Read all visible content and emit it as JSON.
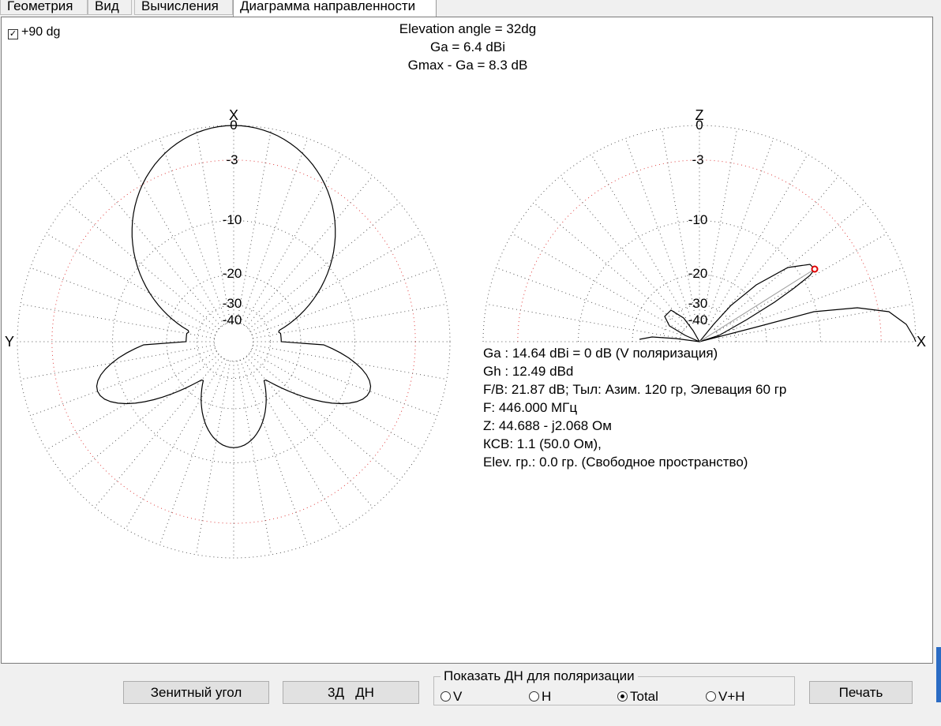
{
  "tabs": [
    {
      "label": "Геометрия",
      "active": false
    },
    {
      "label": "Вид",
      "active": false
    },
    {
      "label": "Вычисления",
      "active": false
    },
    {
      "label": "Диаграмма направленности",
      "active": true
    }
  ],
  "checkbox": {
    "label": "+90 dg",
    "checked": true,
    "glyph": "☑"
  },
  "header": {
    "elevation": "Elevation angle =  32dg",
    "ga": "Ga = 6.4 dBi",
    "gmax": "Gmax - Ga = 8.3 dB"
  },
  "azimuth_plot": {
    "top_axis": "X",
    "left_axis": "Y",
    "ring_labels": [
      "0",
      "-3",
      "-10",
      "-20",
      "-30",
      "-40"
    ]
  },
  "elevation_plot": {
    "top_axis": "Z",
    "right_axis": "X",
    "ring_labels": [
      "0",
      "-3",
      "-10",
      "-20",
      "-30",
      "-40"
    ]
  },
  "info_lines": [
    "Ga : 14.64 dBi = 0 dB  (V поляризация)",
    "Gh : 12.49 dBd",
    "F/B: 21.87 dB; Тыл: Азим. 120 гр, Элевация 60 гр",
    "F: 446.000 МГц",
    "Z: 44.688 - j2.068 Ом",
    "КСВ: 1.1 (50.0 Ом),",
    "Elev. гр.: 0.0 гр. (Свободное пространство)"
  ],
  "buttons": {
    "zenith": "Зенитный угол",
    "three_d": "3Д   ДН",
    "print": "Печать"
  },
  "polarization": {
    "title": "Показать ДН для поляризации",
    "options": [
      {
        "label": "V",
        "selected": false
      },
      {
        "label": "H",
        "selected": false
      },
      {
        "label": "Total",
        "selected": true
      },
      {
        "label": "V+H",
        "selected": false
      }
    ]
  },
  "colors": {
    "grid": "#555555",
    "ref_ring": "#e04040",
    "pattern": "#000000",
    "marker": "#e00000",
    "beam_line": "#999999"
  }
}
